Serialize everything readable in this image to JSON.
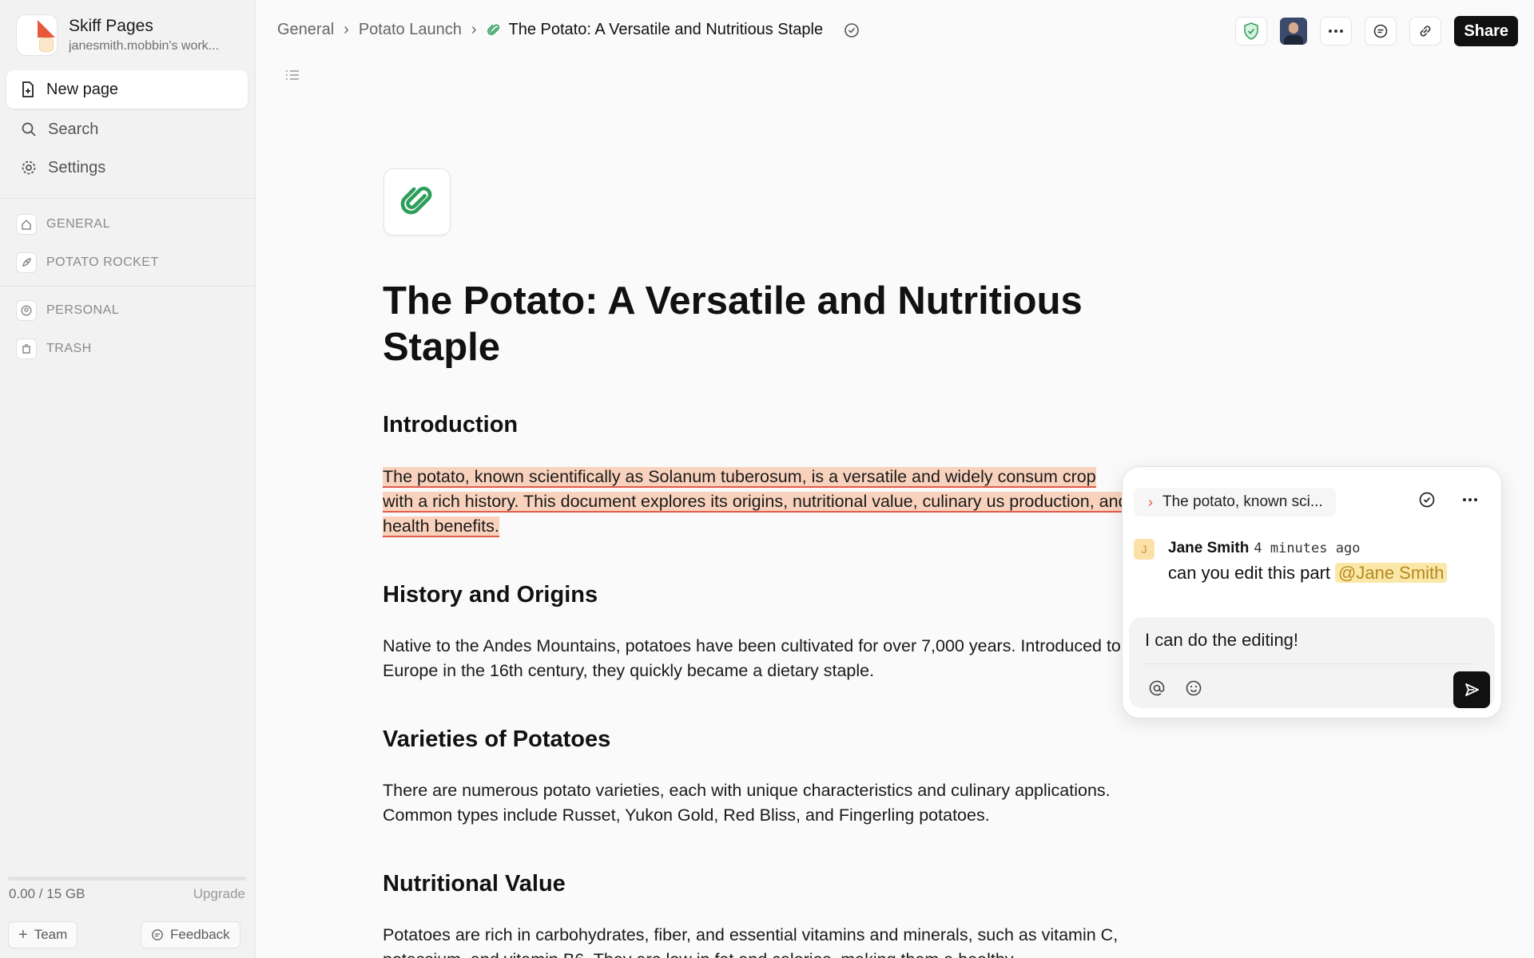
{
  "workspace": {
    "name": "Skiff Pages",
    "subtitle": "janesmith.mobbin's work..."
  },
  "sidebar": {
    "new_page": "New page",
    "search": "Search",
    "settings": "Settings",
    "sections": [
      {
        "label": "GENERAL",
        "icon": "home-icon"
      },
      {
        "label": "POTATO ROCKET",
        "icon": "rocket-icon"
      },
      {
        "label": "PERSONAL",
        "icon": "user-circle-icon"
      },
      {
        "label": "TRASH",
        "icon": "trash-icon"
      }
    ],
    "storage": "0.00 / 15 GB",
    "storage_fraction": 0.0,
    "upgrade": "Upgrade",
    "team": "Team",
    "feedback": "Feedback"
  },
  "breadcrumb": {
    "items": [
      "General",
      "Potato Launch"
    ],
    "current": "The Potato: A Versatile and Nutritious Staple"
  },
  "toolbar": {
    "share": "Share"
  },
  "doc": {
    "title": "The Potato: A Versatile and Nutritious Staple",
    "sections": [
      {
        "heading": "Introduction",
        "body": "The potato, known scientifically as Solanum tuberosum, is a versatile and widely consum crop with a rich history. This document explores its origins, nutritional value, culinary us production, and health benefits."
      },
      {
        "heading": "History and Origins",
        "body": "Native to the Andes Mountains, potatoes have been cultivated for over 7,000 years. Introduced to Europe in the 16th century, they quickly became a dietary staple."
      },
      {
        "heading": "Varieties of Potatoes",
        "body": "There are numerous potato varieties, each with unique characteristics and culinary applications. Common types include Russet, Yukon Gold, Red Bliss, and Fingerling potatoes."
      },
      {
        "heading": "Nutritional Value",
        "body": "Potatoes are rich in carbohydrates, fiber, and essential vitamins and minerals, such as vitamin C, potassium, and vitamin B6. They are low in fat and calories, making them a healthy"
      }
    ]
  },
  "comment": {
    "quote": "The potato, known sci...",
    "author": "Jane Smith",
    "author_initial": "J",
    "time": "4 minutes ago",
    "text": "can you edit this part",
    "mention": "@Jane Smith",
    "reply": "I can do the editing!"
  },
  "colors": {
    "accent": "#e35b4a",
    "highlight": "#f9d2bd",
    "mention_bg": "#fbe7a8",
    "page_icon": "#2e9e5b"
  }
}
